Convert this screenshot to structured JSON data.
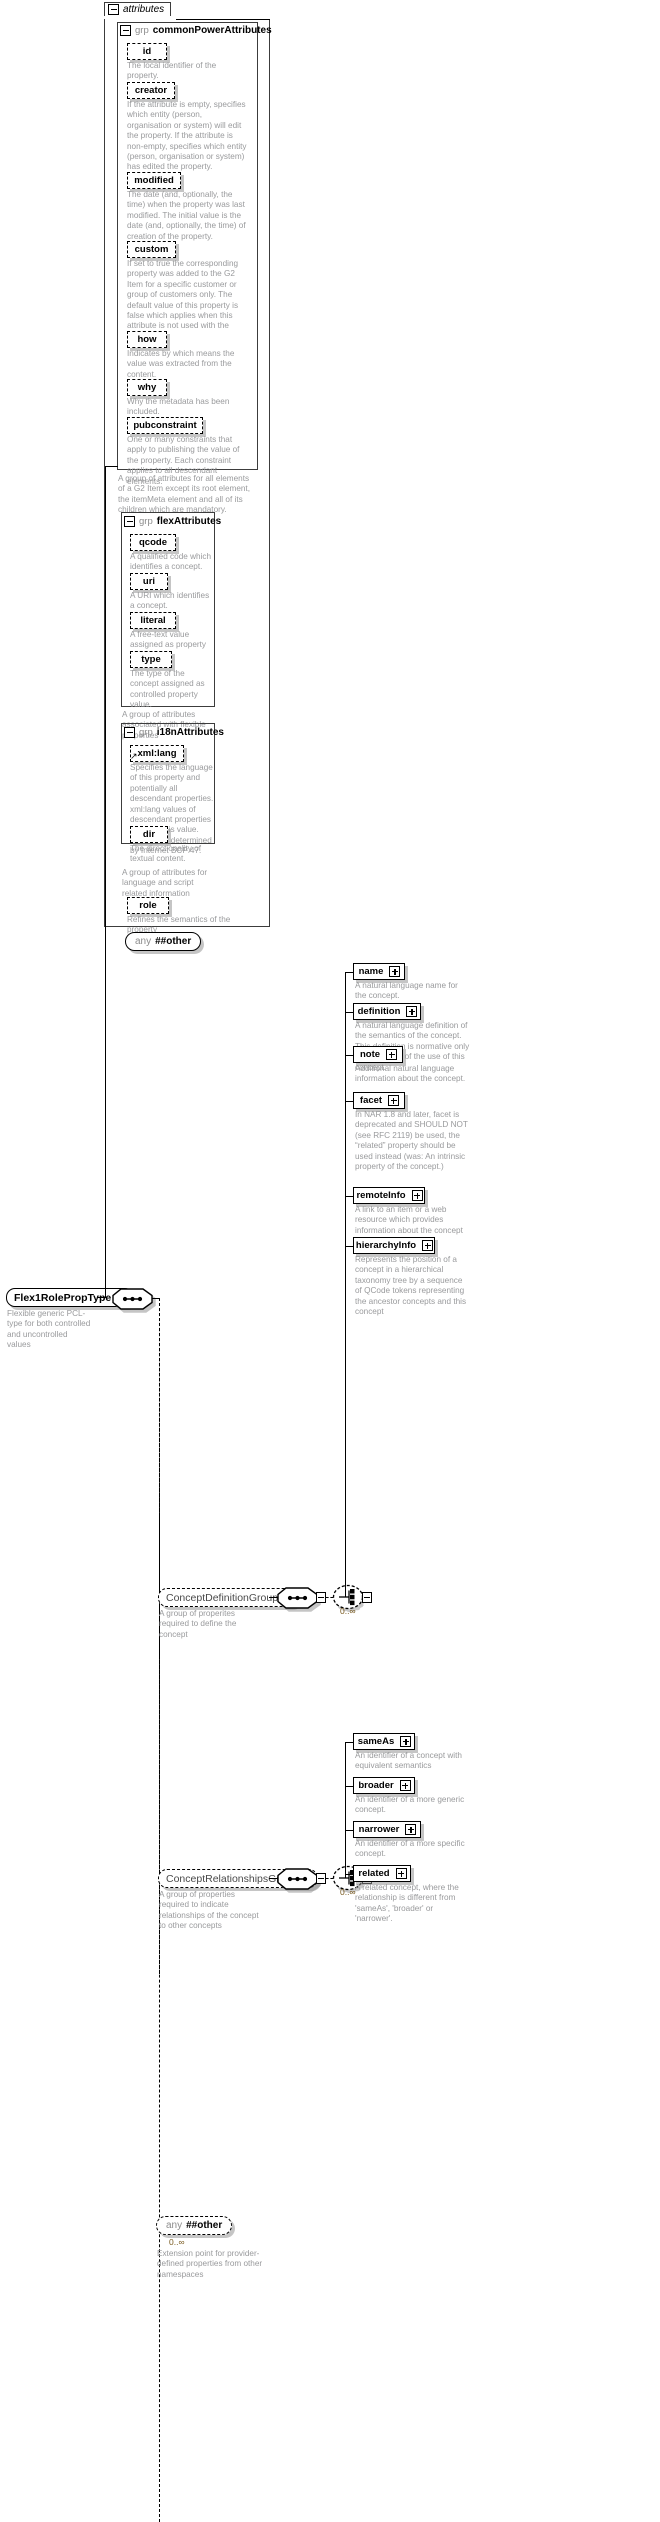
{
  "diagram": {
    "kind": "xml-schema-type-diagram",
    "root_type": {
      "name": "Flex1RolePropType",
      "annotation": "Flexible generic PCL-type for both controlled and uncontrolled values"
    },
    "attributes_tab": {
      "label": "attributes"
    },
    "groups": [
      {
        "keyword": "grp",
        "name": "commonPowerAttributes",
        "annotation": "A group of attributes for all elements of a G2 Item except its root element, the itemMeta element and all of its children which are mandatory.",
        "attributes": [
          {
            "name": "id",
            "annotation": "The local identifier of the property."
          },
          {
            "name": "creator",
            "annotation": "If the attribute is empty, specifies which entity (person, organisation or system) will edit the property. If the attribute is non-empty, specifies which entity (person, organisation or system) has edited the property."
          },
          {
            "name": "modified",
            "annotation": "The date (and, optionally, the time) when the property was last modified. The initial value is the date (and, optionally, the time) of creation of the property."
          },
          {
            "name": "custom",
            "annotation": "If set to true the corresponding property was added to the G2 Item for a specific customer or group of customers only. The default value of this property is false which applies when this attribute is not used with the property."
          },
          {
            "name": "how",
            "annotation": "Indicates by which means the value was extracted from the content."
          },
          {
            "name": "why",
            "annotation": "Why the metadata has been included."
          },
          {
            "name": "pubconstraint",
            "annotation": "One or many constraints that apply to publishing the value of the property. Each constraint applies to all descendant elements."
          }
        ]
      },
      {
        "keyword": "grp",
        "name": "flexAttributes",
        "annotation": "A group of attributes associated with flexible properties",
        "attributes": [
          {
            "name": "qcode",
            "annotation": "A qualified code which identifies a concept."
          },
          {
            "name": "uri",
            "annotation": "A URI which identifies a concept."
          },
          {
            "name": "literal",
            "annotation": "A free-text value assigned as property value."
          },
          {
            "name": "type",
            "annotation": "The type of the concept assigned as controlled property value."
          }
        ]
      },
      {
        "keyword": "grp",
        "name": "i18nAttributes",
        "annotation": "A group of attributes for language and script related information",
        "attributes": [
          {
            "name": "xml:lang",
            "annotation": "Specifies the language of this property and potentially all descendant properties. xml:lang values of descendant properties override this value. Values are determined by Internet BCP 47.",
            "is_reference": true
          },
          {
            "name": "dir",
            "annotation": "The directionality of textual content."
          }
        ]
      }
    ],
    "standalone_attributes": [
      {
        "name": "role",
        "annotation": "Refines the semantics of the property"
      }
    ],
    "attribute_wildcard": {
      "keyword": "any",
      "name": "##other"
    },
    "content_groups": [
      {
        "name": "ConceptDefinitionGroup",
        "annotation": "A group of properites required to define the concept",
        "occurs": "0..∞",
        "elements": [
          {
            "name": "name",
            "annotation": "A natural language name for the concept."
          },
          {
            "name": "definition",
            "annotation": "A natural language definition of the semantics of the concept. This definition is normative only for the scope of the use of this concept."
          },
          {
            "name": "note",
            "annotation": "Additional natural language information about the concept."
          },
          {
            "name": "facet",
            "annotation": "In NAR 1.8 and later, facet is deprecated and SHOULD NOT (see RFC 2119) be used, the “related” property should be used instead (was: An intrinsic property of the concept.)"
          },
          {
            "name": "remoteInfo",
            "annotation": "A link to an item or a web resource which provides information about the concept"
          },
          {
            "name": "hierarchyInfo",
            "annotation": "Represents the position of a concept in a hierarchical taxonomy tree by a sequence of QCode tokens representing the ancestor concepts and this concept"
          }
        ]
      },
      {
        "name": "ConceptRelationshipsGroup",
        "annotation": "A group of properties required to indicate relationships of the concept to other concepts",
        "occurs": "0..∞",
        "elements": [
          {
            "name": "sameAs",
            "annotation": "An identifier of a concept with equivalent semantics"
          },
          {
            "name": "broader",
            "annotation": "An identifier of a more generic concept."
          },
          {
            "name": "narrower",
            "annotation": "An identifier of a more specific concept."
          },
          {
            "name": "related",
            "annotation": "A related concept, where the relationship is different from 'sameAs', 'broader' or 'narrower'."
          }
        ]
      }
    ],
    "content_wildcard": {
      "keyword": "any",
      "name": "##other",
      "occurs": "0..∞",
      "annotation": "Extension point for provider-defined properties from other namespaces"
    },
    "colors": {
      "annotation_text": "#999a9c",
      "keyword_text": "#8c8c8c",
      "occurs_text": "#7a5b20",
      "line": "#000000",
      "shadow": "rgba(150,150,150,0.55)"
    }
  }
}
